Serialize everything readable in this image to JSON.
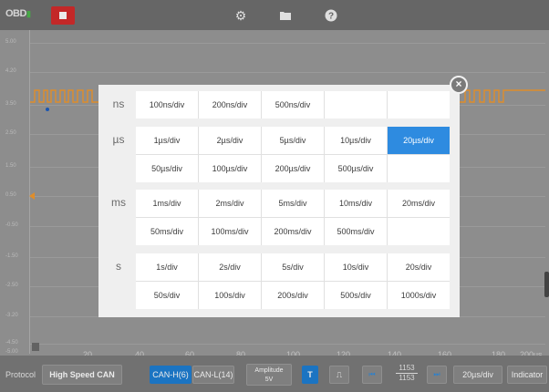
{
  "toolbar": {
    "logo_text": "OBD",
    "icons": [
      "stop-icon",
      "gear-icon",
      "folder-icon",
      "help-icon"
    ]
  },
  "plot": {
    "y_labels": [
      "5.00",
      "4.20",
      "3.50",
      "2.50",
      "1.50",
      "0.50",
      "-0.50",
      "-1.50",
      "-2.50",
      "-3.20",
      "-4.50",
      "-5.00"
    ],
    "x_labels": [
      "20",
      "40",
      "60",
      "80",
      "100",
      "120",
      "140",
      "160",
      "180",
      "200us"
    ]
  },
  "popup": {
    "rows": [
      {
        "unit": "ns",
        "options": [
          [
            "100ns/div",
            "200ns/div",
            "500ns/div",
            "",
            ""
          ]
        ]
      },
      {
        "unit": "µs",
        "options": [
          [
            "1µs/div",
            "2µs/div",
            "5µs/div",
            "10µs/div",
            "20µs/div"
          ],
          [
            "50µs/div",
            "100µs/div",
            "200µs/div",
            "500µs/div",
            ""
          ]
        ]
      },
      {
        "unit": "ms",
        "options": [
          [
            "1ms/div",
            "2ms/div",
            "5ms/div",
            "10ms/div",
            "20ms/div"
          ],
          [
            "50ms/div",
            "100ms/div",
            "200ms/div",
            "500ms/div",
            ""
          ]
        ]
      },
      {
        "unit": "s",
        "options": [
          [
            "1s/div",
            "2s/div",
            "5s/div",
            "10s/div",
            "20s/div"
          ],
          [
            "50s/div",
            "100s/div",
            "200s/div",
            "500s/div",
            "1000s/div"
          ]
        ]
      }
    ],
    "selected": "20µs/div"
  },
  "bottom": {
    "protocol_label": "Protocol",
    "protocol_value": "High Speed CAN",
    "can_h": "CAN-H(6)",
    "can_l": "CAN-L(14)",
    "amplitude_label": "Amplitude",
    "amplitude_value": "5V",
    "trigger": "T",
    "counter_top": "1153",
    "counter_bottom": "1153",
    "timebase": "20µs/div",
    "indicator": "Indicator"
  },
  "colors": {
    "accent": "#2e8be0",
    "stop": "#d42c2c",
    "signal": "#f29a2e"
  }
}
